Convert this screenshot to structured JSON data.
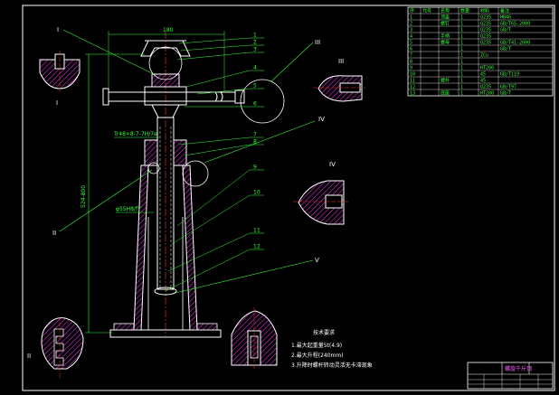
{
  "drawing": {
    "colors": {
      "background": "#000000",
      "frame": "#ffffff",
      "outline": "#ffffff",
      "centerline": "#ff3333",
      "hatch": "#ff33ff",
      "dimension": "#33ff33",
      "leader": "#33ff33",
      "section": "#ffff33"
    },
    "view_labels": {
      "detail_top_left": "I",
      "detail_top_left_below": "I",
      "detail_right_top": "III",
      "detail_right_top_below": "III",
      "detail_right_mid": "IV",
      "detail_right_mid_below": "IV",
      "detail_bottom_left": "II",
      "detail_bottom_left_below": "II",
      "detail_bottom_right": "V"
    },
    "dimensions": {
      "top_width": "180",
      "overall_height": "524-800",
      "fit_1": "Tr48×8-7-7H/7e",
      "fit_2": "φ55H8/f7"
    },
    "part_numbers": [
      "1",
      "2",
      "3",
      "4",
      "5",
      "6",
      "7",
      "8",
      "9",
      "10",
      "11",
      "12"
    ]
  },
  "parts_table": {
    "header": [
      "序",
      "代号",
      "名称",
      "数量",
      "材料",
      "备注"
    ],
    "rows": [
      [
        "1",
        "",
        "顶盖",
        "1",
        "Q235",
        "HB46"
      ],
      [
        "2",
        "",
        "螺钉",
        "1",
        "Q235",
        "GB/T65-2000"
      ],
      [
        "3",
        "",
        "",
        "1",
        "Q235",
        "GB/T"
      ],
      [
        "4",
        "",
        "手柄",
        "1",
        "Q235",
        ""
      ],
      [
        "5",
        "",
        "螺母",
        "1",
        "Q235",
        "GB/T41-2000"
      ],
      [
        "6",
        "",
        "",
        "1",
        "",
        "GB/T"
      ],
      [
        "7",
        "",
        "",
        "1",
        "ZCu",
        ""
      ],
      [
        "8",
        "",
        "",
        "1",
        "",
        ""
      ],
      [
        "9",
        "",
        "",
        "1",
        "HT200",
        ""
      ],
      [
        "10",
        "",
        "",
        "1",
        "45",
        "GB/T119"
      ],
      [
        "11",
        "",
        "螺杆",
        "1",
        "45",
        ""
      ],
      [
        "12",
        "",
        "",
        "1",
        "Q235",
        "GB/T97"
      ],
      [
        "13",
        "",
        "底座",
        "1",
        "HT200",
        "GB/T"
      ]
    ]
  },
  "tech_notes": {
    "heading": "技术要求",
    "items": [
      "1.最大起重量5t(4.9)",
      "2.最大升程(240mm)",
      "3.升降时螺杆转动灵活无卡滞现象"
    ]
  },
  "title_block": {
    "name": "螺旋千斤顶"
  }
}
